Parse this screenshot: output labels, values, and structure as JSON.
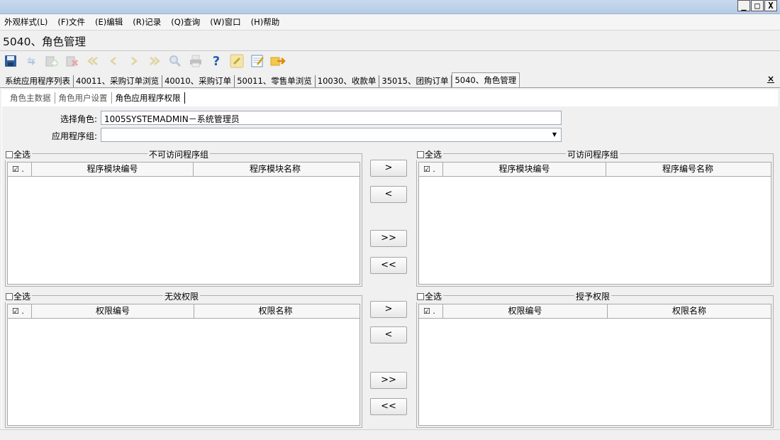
{
  "menu": [
    "外观样式(L)",
    "(F)文件",
    "(E)编辑",
    "(R)记录",
    "(Q)查询",
    "(W)窗口",
    "(H)帮助"
  ],
  "window_buttons": [
    "_",
    "□",
    "X"
  ],
  "doc_title": "5040、角色管理",
  "toolbar_icons": [
    "save-icon",
    "refresh-icon",
    "add-icon",
    "delete-icon",
    "first-record-icon",
    "previous-record-icon",
    "next-record-icon",
    "last-record-icon",
    "search-icon",
    "print-icon",
    "help-icon",
    "edit-icon",
    "report-icon",
    "exit-icon"
  ],
  "tabs": [
    "系统应用程序列表",
    "40011、采购订单浏览",
    "40010、采购订单",
    "50011、零售单浏览",
    "10030、收款单",
    "35015、团购订单",
    "5040、角色管理"
  ],
  "tab_close": "×",
  "subtabs": [
    "角色主数据",
    "角色用户设置",
    "角色应用程序权限"
  ],
  "form": {
    "role_label": "选择角色:",
    "role_value": "1005SYSTEMADMIN－系统管理员",
    "app_group_label": "应用程序组:",
    "app_group_value": ""
  },
  "select_all_label": "全选",
  "groups": {
    "inaccessible": {
      "title": "不可访问程序组",
      "columns": [
        "☑ .",
        "程序模块编号",
        "程序模块名称"
      ]
    },
    "accessible": {
      "title": "可访问程序组",
      "columns": [
        "☑ .",
        "程序模块编号",
        "程序编号名称"
      ]
    },
    "invalid_perm": {
      "title": "无效权限",
      "columns": [
        "☑ .",
        "权限编号",
        "权限名称"
      ]
    },
    "granted_perm": {
      "title": "授予权限",
      "columns": [
        "☑ .",
        "权限编号",
        "权限名称"
      ]
    }
  },
  "move_buttons": {
    "right": ">",
    "left": "<",
    "all_right": ">>",
    "all_left": "<<"
  }
}
